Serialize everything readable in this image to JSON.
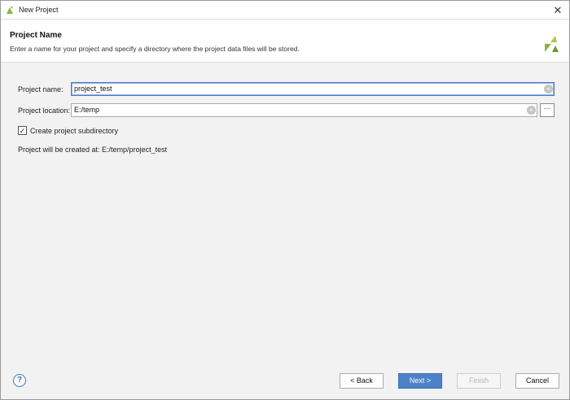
{
  "window": {
    "title": "New Project",
    "close_glyph": "✕"
  },
  "header": {
    "title": "Project Name",
    "description": "Enter a name for your project and specify a directory where the project data files will be stored.",
    "logo_icon": "xilinx-logo-icon",
    "accent_color": "#8cb33f"
  },
  "form": {
    "project_name_label": "Project name:",
    "project_name_value": "project_test",
    "project_location_label": "Project location:",
    "project_location_value": "E:/temp",
    "browse_label": "···",
    "create_subdir_label": "Create project subdirectory",
    "create_subdir_checked": true,
    "created_at_text": "Project will be created at: E:/temp/project_test"
  },
  "footer": {
    "help_label": "?",
    "back_label": "< Back",
    "next_label": "Next >",
    "finish_label": "Finish",
    "cancel_label": "Cancel"
  }
}
